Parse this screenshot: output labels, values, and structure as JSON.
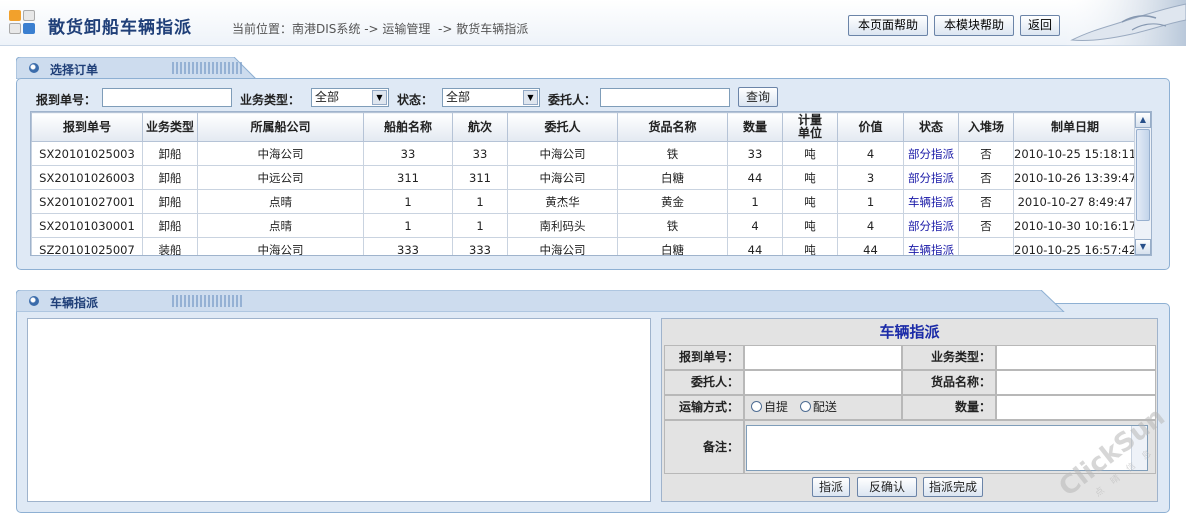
{
  "header": {
    "title": "散货卸船车辆指派",
    "breadcrumb": "当前位置：南港DIS系统 -> 运输管理  -> 散货车辆指派",
    "buttons": [
      "本页面帮助",
      "本模块帮助",
      "返回"
    ]
  },
  "order_panel": {
    "tab_label": "选择订单",
    "search": {
      "report_no_label": "报到单号：",
      "report_no_value": "",
      "biz_type_label": "业务类型：",
      "biz_type_value": "全部",
      "status_label": "状态：",
      "status_value": "全部",
      "consignor_label": "委托人：",
      "consignor_value": "",
      "query_button": "查询"
    },
    "columns": [
      "报到单号",
      "业务类型",
      "所属船公司",
      "船舶名称",
      "航次",
      "委托人",
      "货品名称",
      "数量",
      "计量\n单位",
      "价值",
      "状态",
      "入堆场",
      "制单日期"
    ],
    "rows": [
      [
        "SX20101025003",
        "卸船",
        "中海公司",
        "33",
        "33",
        "中海公司",
        "铁",
        "33",
        "吨",
        "4",
        "部分指派",
        "否",
        "2010-10-25 15:18:11"
      ],
      [
        "SX20101026003",
        "卸船",
        "中远公司",
        "311",
        "311",
        "中海公司",
        "白糖",
        "44",
        "吨",
        "3",
        "部分指派",
        "否",
        "2010-10-26 13:39:47"
      ],
      [
        "SX20101027001",
        "卸船",
        "点晴",
        "1",
        "1",
        "黄杰华",
        "黄金",
        "1",
        "吨",
        "1",
        "车辆指派",
        "否",
        "2010-10-27 8:49:47"
      ],
      [
        "SX20101030001",
        "卸船",
        "点晴",
        "1",
        "1",
        "南利码头",
        "铁",
        "4",
        "吨",
        "4",
        "部分指派",
        "否",
        "2010-10-30 10:16:17"
      ],
      [
        "SZ20101025007",
        "装船",
        "中海公司",
        "333",
        "333",
        "中海公司",
        "白糖",
        "44",
        "吨",
        "44",
        "车辆指派",
        "",
        "2010-10-25 16:57:42"
      ]
    ]
  },
  "dispatch_panel": {
    "tab_label": "车辆指派",
    "form_title": "车辆指派",
    "report_no_label": "报到单号：",
    "biz_type_label": "业务类型：",
    "consignor_label": "委托人：",
    "goods_label": "货品名称：",
    "transport_label": "运输方式：",
    "transport_options": [
      "自提",
      "配送"
    ],
    "quantity_label": "数量：",
    "notes_label": "备注：",
    "actions": [
      "指派",
      "反确认",
      "指派完成"
    ]
  },
  "watermark": {
    "brand": "ClickSun",
    "subtitle": "点 晴 信 息"
  }
}
